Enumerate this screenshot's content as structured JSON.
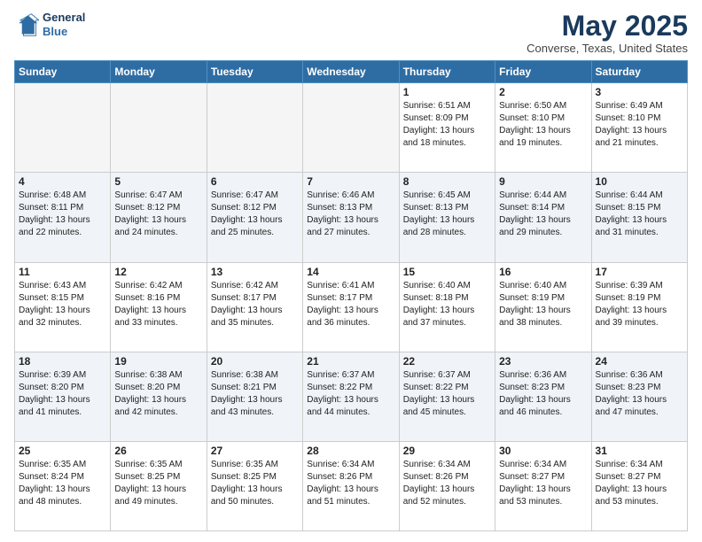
{
  "logo": {
    "line1": "General",
    "line2": "Blue"
  },
  "title": "May 2025",
  "location": "Converse, Texas, United States",
  "days_header": [
    "Sunday",
    "Monday",
    "Tuesday",
    "Wednesday",
    "Thursday",
    "Friday",
    "Saturday"
  ],
  "weeks": [
    [
      {
        "day": "",
        "info": ""
      },
      {
        "day": "",
        "info": ""
      },
      {
        "day": "",
        "info": ""
      },
      {
        "day": "",
        "info": ""
      },
      {
        "day": "1",
        "info": "Sunrise: 6:51 AM\nSunset: 8:09 PM\nDaylight: 13 hours\nand 18 minutes."
      },
      {
        "day": "2",
        "info": "Sunrise: 6:50 AM\nSunset: 8:10 PM\nDaylight: 13 hours\nand 19 minutes."
      },
      {
        "day": "3",
        "info": "Sunrise: 6:49 AM\nSunset: 8:10 PM\nDaylight: 13 hours\nand 21 minutes."
      }
    ],
    [
      {
        "day": "4",
        "info": "Sunrise: 6:48 AM\nSunset: 8:11 PM\nDaylight: 13 hours\nand 22 minutes."
      },
      {
        "day": "5",
        "info": "Sunrise: 6:47 AM\nSunset: 8:12 PM\nDaylight: 13 hours\nand 24 minutes."
      },
      {
        "day": "6",
        "info": "Sunrise: 6:47 AM\nSunset: 8:12 PM\nDaylight: 13 hours\nand 25 minutes."
      },
      {
        "day": "7",
        "info": "Sunrise: 6:46 AM\nSunset: 8:13 PM\nDaylight: 13 hours\nand 27 minutes."
      },
      {
        "day": "8",
        "info": "Sunrise: 6:45 AM\nSunset: 8:13 PM\nDaylight: 13 hours\nand 28 minutes."
      },
      {
        "day": "9",
        "info": "Sunrise: 6:44 AM\nSunset: 8:14 PM\nDaylight: 13 hours\nand 29 minutes."
      },
      {
        "day": "10",
        "info": "Sunrise: 6:44 AM\nSunset: 8:15 PM\nDaylight: 13 hours\nand 31 minutes."
      }
    ],
    [
      {
        "day": "11",
        "info": "Sunrise: 6:43 AM\nSunset: 8:15 PM\nDaylight: 13 hours\nand 32 minutes."
      },
      {
        "day": "12",
        "info": "Sunrise: 6:42 AM\nSunset: 8:16 PM\nDaylight: 13 hours\nand 33 minutes."
      },
      {
        "day": "13",
        "info": "Sunrise: 6:42 AM\nSunset: 8:17 PM\nDaylight: 13 hours\nand 35 minutes."
      },
      {
        "day": "14",
        "info": "Sunrise: 6:41 AM\nSunset: 8:17 PM\nDaylight: 13 hours\nand 36 minutes."
      },
      {
        "day": "15",
        "info": "Sunrise: 6:40 AM\nSunset: 8:18 PM\nDaylight: 13 hours\nand 37 minutes."
      },
      {
        "day": "16",
        "info": "Sunrise: 6:40 AM\nSunset: 8:19 PM\nDaylight: 13 hours\nand 38 minutes."
      },
      {
        "day": "17",
        "info": "Sunrise: 6:39 AM\nSunset: 8:19 PM\nDaylight: 13 hours\nand 39 minutes."
      }
    ],
    [
      {
        "day": "18",
        "info": "Sunrise: 6:39 AM\nSunset: 8:20 PM\nDaylight: 13 hours\nand 41 minutes."
      },
      {
        "day": "19",
        "info": "Sunrise: 6:38 AM\nSunset: 8:20 PM\nDaylight: 13 hours\nand 42 minutes."
      },
      {
        "day": "20",
        "info": "Sunrise: 6:38 AM\nSunset: 8:21 PM\nDaylight: 13 hours\nand 43 minutes."
      },
      {
        "day": "21",
        "info": "Sunrise: 6:37 AM\nSunset: 8:22 PM\nDaylight: 13 hours\nand 44 minutes."
      },
      {
        "day": "22",
        "info": "Sunrise: 6:37 AM\nSunset: 8:22 PM\nDaylight: 13 hours\nand 45 minutes."
      },
      {
        "day": "23",
        "info": "Sunrise: 6:36 AM\nSunset: 8:23 PM\nDaylight: 13 hours\nand 46 minutes."
      },
      {
        "day": "24",
        "info": "Sunrise: 6:36 AM\nSunset: 8:23 PM\nDaylight: 13 hours\nand 47 minutes."
      }
    ],
    [
      {
        "day": "25",
        "info": "Sunrise: 6:35 AM\nSunset: 8:24 PM\nDaylight: 13 hours\nand 48 minutes."
      },
      {
        "day": "26",
        "info": "Sunrise: 6:35 AM\nSunset: 8:25 PM\nDaylight: 13 hours\nand 49 minutes."
      },
      {
        "day": "27",
        "info": "Sunrise: 6:35 AM\nSunset: 8:25 PM\nDaylight: 13 hours\nand 50 minutes."
      },
      {
        "day": "28",
        "info": "Sunrise: 6:34 AM\nSunset: 8:26 PM\nDaylight: 13 hours\nand 51 minutes."
      },
      {
        "day": "29",
        "info": "Sunrise: 6:34 AM\nSunset: 8:26 PM\nDaylight: 13 hours\nand 52 minutes."
      },
      {
        "day": "30",
        "info": "Sunrise: 6:34 AM\nSunset: 8:27 PM\nDaylight: 13 hours\nand 53 minutes."
      },
      {
        "day": "31",
        "info": "Sunrise: 6:34 AM\nSunset: 8:27 PM\nDaylight: 13 hours\nand 53 minutes."
      }
    ]
  ]
}
